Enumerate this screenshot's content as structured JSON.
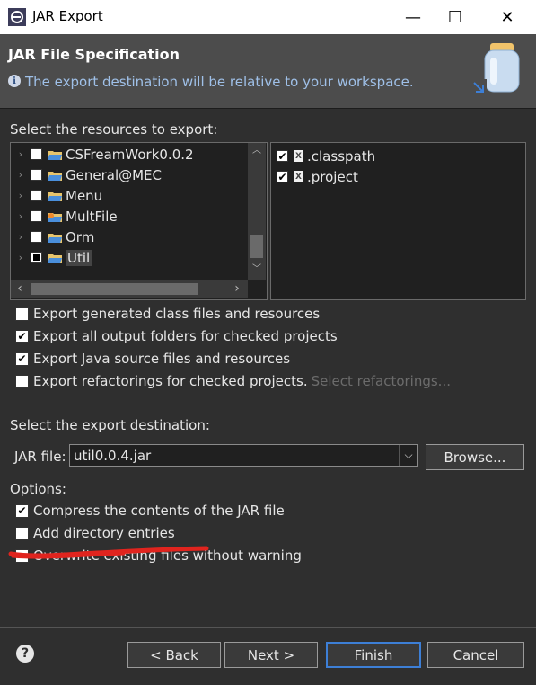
{
  "window": {
    "title": "JAR Export",
    "controls": {
      "minimize": "—",
      "maximize": "☐",
      "close": "✕"
    }
  },
  "header": {
    "title": "JAR File Specification",
    "info": "The export destination will be relative to your workspace."
  },
  "resources": {
    "label": "Select the resources to export:",
    "tree": [
      {
        "label": "CSFreamWork0.0.2",
        "checked": false
      },
      {
        "label": "General@MEC",
        "checked": false
      },
      {
        "label": "Menu",
        "checked": false
      },
      {
        "label": "MultFile",
        "checked": false
      },
      {
        "label": "Orm",
        "checked": false
      },
      {
        "label": "Util",
        "checked": "partial"
      }
    ],
    "files": [
      {
        "label": ".classpath",
        "checked": true
      },
      {
        "label": ".project",
        "checked": true
      }
    ]
  },
  "export_options": [
    {
      "label": "Export generated class files and resources",
      "checked": false
    },
    {
      "label": "Export all output folders for checked projects",
      "checked": true
    },
    {
      "label": "Export Java source files and resources",
      "checked": true
    },
    {
      "label": "Export refactorings for checked projects.",
      "checked": false,
      "link": "Select refactorings..."
    }
  ],
  "destination": {
    "label": "Select the export destination:",
    "jar_label": "JAR file:",
    "jar_value": "util0.0.4.jar",
    "browse": "Browse..."
  },
  "options": {
    "label": "Options:",
    "items": [
      {
        "label": "Compress the contents of the JAR file",
        "checked": true
      },
      {
        "label": "Add directory entries",
        "checked": false
      },
      {
        "label": "Overwrite existing files without warning",
        "checked": false
      }
    ]
  },
  "buttons": {
    "help": "?",
    "back": "< Back",
    "next": "Next >",
    "finish": "Finish",
    "cancel": "Cancel"
  },
  "colors": {
    "accent": "#3d7fd6",
    "annotation": "#e0241e",
    "info_text": "#9fc0e8"
  }
}
